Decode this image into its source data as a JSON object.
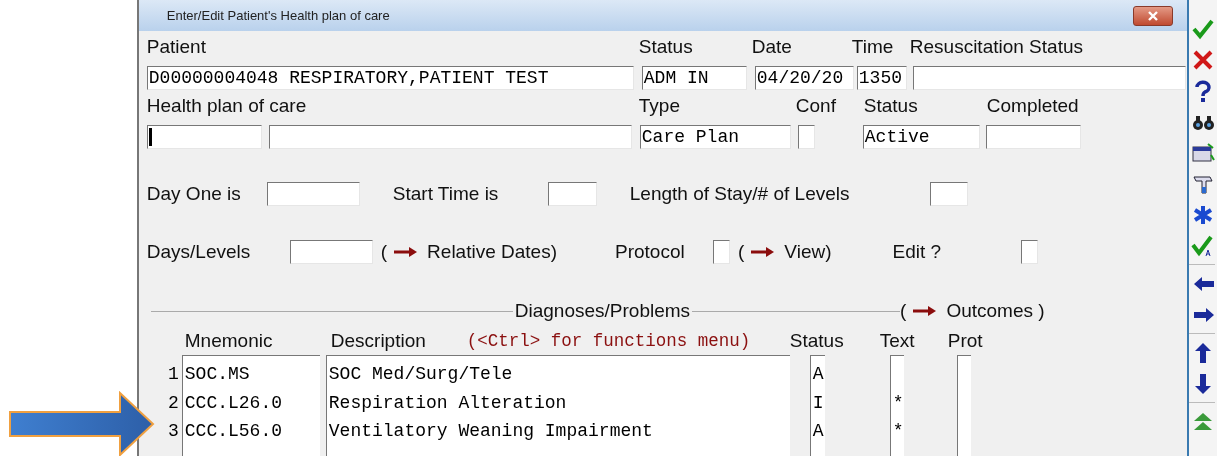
{
  "window": {
    "title": "Enter/Edit Patient's Health plan of care"
  },
  "patient_row": {
    "patient": {
      "label": "Patient",
      "value": "D00000004048 RESPIRATORY,PATIENT TEST"
    },
    "status": {
      "label": "Status",
      "value": "ADM IN"
    },
    "date": {
      "label": "Date",
      "value": "04/20/20"
    },
    "time": {
      "label": "Time",
      "value": "1350"
    },
    "resuscitation_status": {
      "label": "Resuscitation Status"
    }
  },
  "plan_row": {
    "health_plan": {
      "label": "Health plan of care",
      "focused": true
    },
    "type": {
      "label": "Type",
      "value": "Care Plan"
    },
    "conf": {
      "label": "Conf",
      "checked": false
    },
    "status": {
      "label": "Status",
      "value": "Active"
    },
    "completed": {
      "label": "Completed"
    }
  },
  "day_one": {
    "label": "Day One is"
  },
  "start_time": {
    "label": "Start Time is"
  },
  "length_of_stay": {
    "label": "Length of Stay/# of Levels"
  },
  "days_levels": {
    "label": "Days/Levels"
  },
  "relative_dates": {
    "open": "(",
    "label": "Relative Dates)"
  },
  "protocol": {
    "label": "Protocol",
    "checked": false
  },
  "view": {
    "open": "(",
    "label": "View)"
  },
  "edit": {
    "label": "Edit ?",
    "checked": false
  },
  "section": {
    "title": "Diagnoses/Problems",
    "outcomes": {
      "open": "(",
      "label": "Outcomes )"
    }
  },
  "columns": {
    "mnemonic": "Mnemonic",
    "description": "Description",
    "hint": "(<Ctrl> for functions menu)",
    "status": "Status",
    "text": "Text",
    "prot": "Prot"
  },
  "rows": [
    {
      "number": "1",
      "mnemonic": "SOC.MS",
      "description": "SOC Med/Surg/Tele",
      "status": "A"
    },
    {
      "number": "2",
      "mnemonic": "CCC.L26.0",
      "description": "Respiration Alteration",
      "status": "I",
      "text": "*"
    },
    {
      "number": "3",
      "mnemonic": "CCC.L56.0",
      "description": "Ventilatory Weaning Impairment",
      "status": "A",
      "text": "*"
    }
  ]
}
